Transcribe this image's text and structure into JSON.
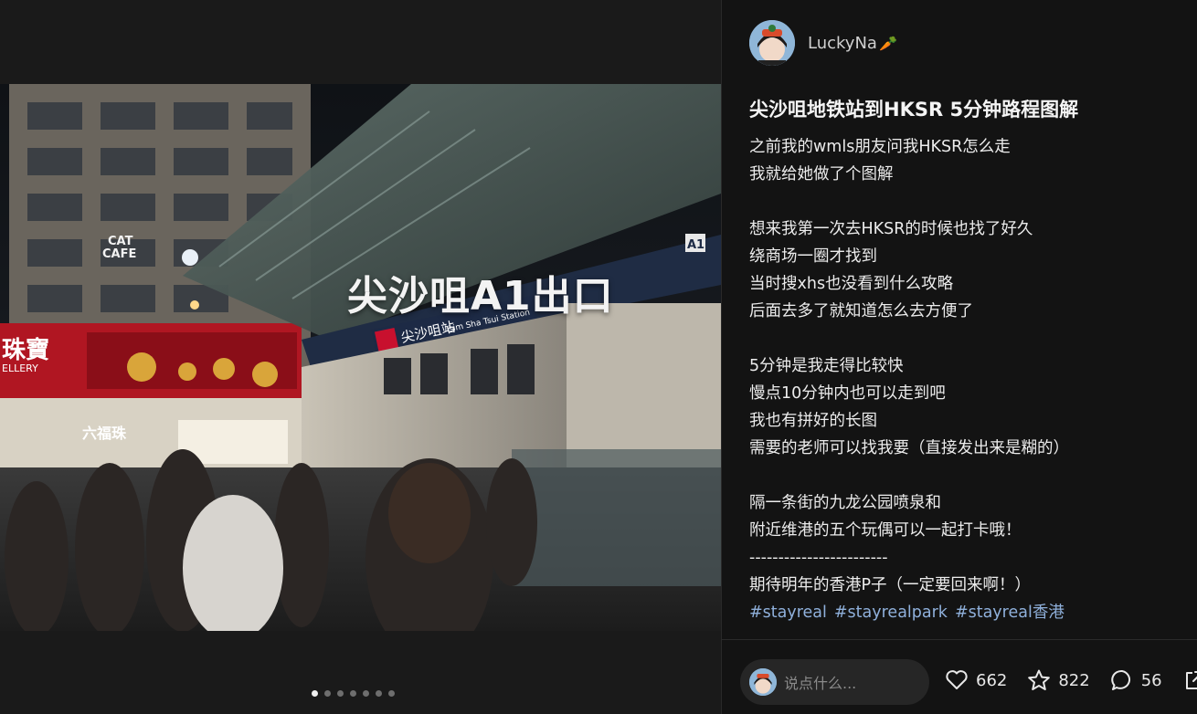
{
  "media": {
    "overlay_text": "尖沙咀A1出口",
    "sign_chinese": "尖沙咀站",
    "sign_english": "Tsim Sha Tsui Station",
    "exit_label": "A1",
    "shop_text_1": "CAT",
    "shop_text_2": "CAFE",
    "shop_text_3": "六福珠",
    "shop_text_4": "珠寶",
    "shop_text_5": "ELLERY",
    "carousel_total": 7,
    "carousel_active": 1
  },
  "author": {
    "name": "LuckyNa",
    "badge": "🥕"
  },
  "post": {
    "title": "尖沙咀地铁站到HKSR 5分钟路程图解",
    "lines": [
      "之前我的wmls朋友问我HKSR怎么走",
      "我就给她做了个图解",
      "",
      "想来我第一次去HKSR的时候也找了好久",
      "绕商场一圈才找到",
      "当时搜xhs也没看到什么攻略",
      "后面去多了就知道怎么去方便了",
      "",
      "5分钟是我走得比较快",
      "慢点10分钟内也可以走到吧",
      "我也有拼好的长图",
      "需要的老师可以找我要（直接发出来是糊的）",
      "",
      "隔一条街的九龙公园喷泉和",
      "附近维港的五个玩偶可以一起打卡哦！",
      "------------------------",
      "期待明年的香港P子（一定要回来啊！）"
    ],
    "tags": [
      "#stayreal",
      "#stayrealpark",
      "#stayreal香港"
    ]
  },
  "engagement": {
    "comment_placeholder": "说点什么...",
    "likes": "662",
    "collects": "822",
    "comments": "56"
  },
  "colors": {
    "tag": "#8fb0db",
    "background": "#131313"
  }
}
